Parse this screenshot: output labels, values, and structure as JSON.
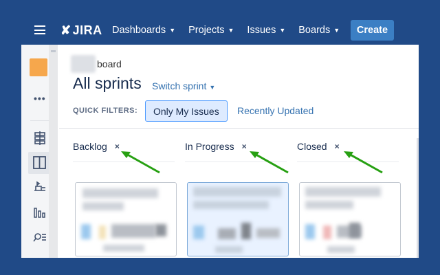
{
  "topnav": {
    "logo_text": "JIRA",
    "logo_mark": "✘",
    "items": [
      {
        "label": "Dashboards"
      },
      {
        "label": "Projects"
      },
      {
        "label": "Issues"
      },
      {
        "label": "Boards"
      }
    ],
    "create_label": "Create"
  },
  "sidebar": {
    "icons": [
      "more-icon",
      "backlog-icon",
      "board-icon",
      "releases-icon",
      "reports-icon",
      "search-issues-icon"
    ]
  },
  "board": {
    "name_suffix": "board",
    "title": "All sprints",
    "switch_sprint": "Switch sprint",
    "quick_filters_label": "QUICK FILTERS:",
    "filters": [
      {
        "label": "Only My Issues",
        "selected": true
      },
      {
        "label": "Recently Updated",
        "selected": false
      }
    ],
    "columns": [
      {
        "name": "Backlog",
        "remove": "×"
      },
      {
        "name": "In Progress",
        "remove": "×"
      },
      {
        "name": "Closed",
        "remove": "×"
      }
    ]
  },
  "colors": {
    "page_background": "#204a87",
    "create_button": "#3b7fc4",
    "annotation_arrow": "#27a012",
    "selected_filter": "#deebff"
  }
}
